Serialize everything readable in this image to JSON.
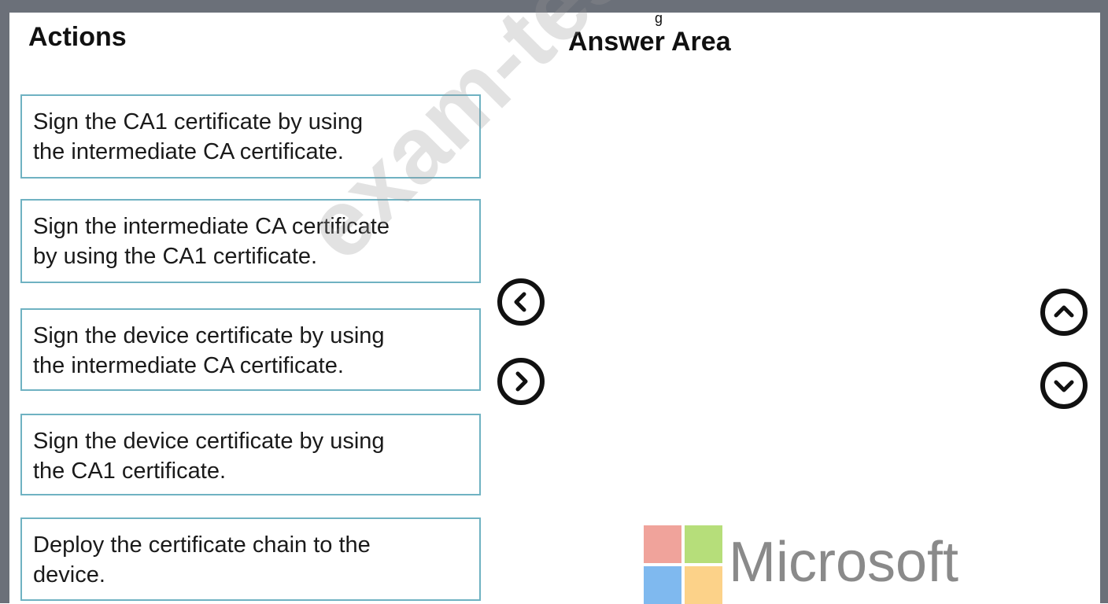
{
  "top_label": "g",
  "actions": {
    "heading": "Actions",
    "items": [
      {
        "line1": "Sign the CA1 certificate by using",
        "line2": "the intermediate CA certificate."
      },
      {
        "line1": "Sign the intermediate CA certificate",
        "line2": "by using the CA1 certificate."
      },
      {
        "line1": "Sign the device certificate by using",
        "line2": "the intermediate CA certificate."
      },
      {
        "line1": "Sign the device certificate by using",
        "line2": "the CA1 certificate."
      },
      {
        "line1": "Deploy the certificate chain to the",
        "line2": "device."
      }
    ]
  },
  "answer_area": {
    "heading": "Answer Area"
  },
  "controls": {
    "move_left_icon": "chevron-left-circle-icon",
    "move_right_icon": "chevron-right-circle-icon",
    "move_up_icon": "chevron-up-circle-icon",
    "move_down_icon": "chevron-down-circle-icon"
  },
  "watermark": "exam-tests.com",
  "logo": {
    "text": "Microsoft",
    "colors": [
      "#f0a39b",
      "#b6de7a",
      "#7fb9ef",
      "#fcd289"
    ]
  },
  "colors": {
    "frame": "#6b7079",
    "card_border": "#6fb2c2"
  }
}
